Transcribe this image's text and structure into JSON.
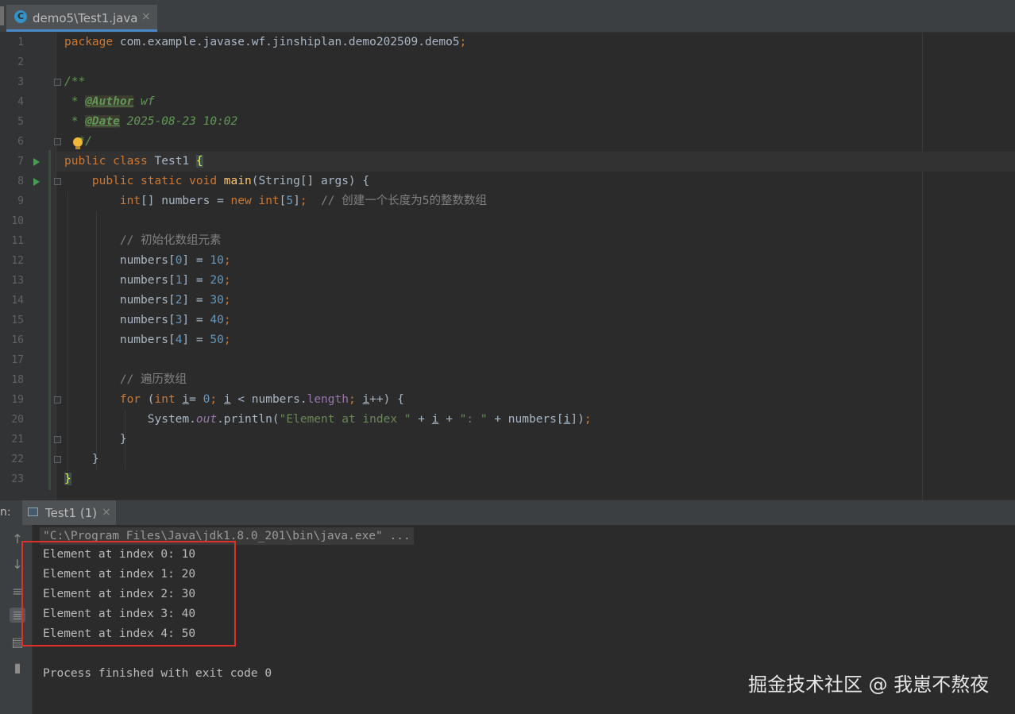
{
  "tab": {
    "icon": "C",
    "title": "demo5\\Test1.java",
    "close": "×"
  },
  "editor": {
    "line_numbers": [
      "1",
      "2",
      "3",
      "4",
      "5",
      "6",
      "7",
      "8",
      "9",
      "10",
      "11",
      "12",
      "13",
      "14",
      "15",
      "16",
      "17",
      "18",
      "19",
      "20",
      "21",
      "22",
      "23"
    ],
    "lines": [
      [
        [
          "kw",
          "package "
        ],
        [
          "",
          "com.example.javase.wf.jinshiplan.demo202509.demo5"
        ],
        [
          "kw",
          ";"
        ]
      ],
      [],
      [
        [
          "doc",
          "/**"
        ]
      ],
      [
        [
          "doc",
          " * "
        ],
        [
          "tag",
          "@Author"
        ],
        [
          "doc",
          " wf"
        ]
      ],
      [
        [
          "doc",
          " * "
        ],
        [
          "tag",
          "@Date"
        ],
        [
          "doc",
          " 2025-08-23 10:02"
        ]
      ],
      [
        [
          "doc",
          "  */"
        ]
      ],
      [
        [
          "kw",
          "public class "
        ],
        [
          "",
          "Test1 "
        ],
        [
          "brace-hl",
          "{"
        ]
      ],
      [
        [
          "",
          "    "
        ],
        [
          "kw",
          "public static void "
        ],
        [
          "fn",
          "main"
        ],
        [
          "",
          "(String[] args) {"
        ]
      ],
      [
        [
          "",
          "        "
        ],
        [
          "kw",
          "int"
        ],
        [
          "",
          "[] numbers = "
        ],
        [
          "kw",
          "new int"
        ],
        [
          "",
          "["
        ],
        [
          "num",
          "5"
        ],
        [
          "",
          "]"
        ],
        [
          "kw",
          ";"
        ],
        [
          "",
          "  "
        ],
        [
          "cm",
          "// 创建一个长度为5的整数数组"
        ]
      ],
      [],
      [
        [
          "",
          "        "
        ],
        [
          "cm",
          "// 初始化数组元素"
        ]
      ],
      [
        [
          "",
          "        numbers["
        ],
        [
          "num",
          "0"
        ],
        [
          "",
          "] = "
        ],
        [
          "num",
          "10"
        ],
        [
          "kw",
          ";"
        ]
      ],
      [
        [
          "",
          "        numbers["
        ],
        [
          "num",
          "1"
        ],
        [
          "",
          "] = "
        ],
        [
          "num",
          "20"
        ],
        [
          "kw",
          ";"
        ]
      ],
      [
        [
          "",
          "        numbers["
        ],
        [
          "num",
          "2"
        ],
        [
          "",
          "] = "
        ],
        [
          "num",
          "30"
        ],
        [
          "kw",
          ";"
        ]
      ],
      [
        [
          "",
          "        numbers["
        ],
        [
          "num",
          "3"
        ],
        [
          "",
          "] = "
        ],
        [
          "num",
          "40"
        ],
        [
          "kw",
          ";"
        ]
      ],
      [
        [
          "",
          "        numbers["
        ],
        [
          "num",
          "4"
        ],
        [
          "",
          "] = "
        ],
        [
          "num",
          "50"
        ],
        [
          "kw",
          ";"
        ]
      ],
      [],
      [
        [
          "",
          "        "
        ],
        [
          "cm",
          "// 遍历数组"
        ]
      ],
      [
        [
          "",
          "        "
        ],
        [
          "kw",
          "for "
        ],
        [
          "",
          "("
        ],
        [
          "kw",
          "int "
        ],
        [
          "ul",
          "i"
        ],
        [
          "",
          "",
          " "
        ],
        [
          "",
          ""
        ],
        [
          "",
          "= "
        ],
        [
          "num",
          "0"
        ],
        [
          "kw",
          "; "
        ],
        [
          "ul",
          "i"
        ],
        [
          "",
          " < numbers."
        ],
        [
          "field",
          "length"
        ],
        [
          "kw",
          "; "
        ],
        [
          "ul",
          "i"
        ],
        [
          "",
          "++) {"
        ]
      ],
      [
        [
          "",
          "            System."
        ],
        [
          "ital-field",
          "out"
        ],
        [
          "",
          ".println("
        ],
        [
          "str",
          "\"Element at index \""
        ],
        [
          "",
          " + "
        ],
        [
          "ul",
          "i"
        ],
        [
          "",
          " + "
        ],
        [
          "str",
          "\": \""
        ],
        [
          "",
          " + numbers["
        ],
        [
          "ul",
          "i"
        ],
        [
          "",
          "])"
        ],
        [
          "kw",
          ";"
        ]
      ],
      [
        [
          "",
          "        }"
        ]
      ],
      [
        [
          "",
          "    }"
        ]
      ],
      [
        [
          "brace-hl",
          "}"
        ]
      ]
    ]
  },
  "run": {
    "prefix": "n:",
    "tab_label": "Test1 (1)",
    "tab_close": "×",
    "command": "\"C:\\Program Files\\Java\\jdk1.8.0_201\\bin\\java.exe\" ...",
    "output": [
      "Element at index 0: 10",
      "Element at index 1: 20",
      "Element at index 2: 30",
      "Element at index 3: 40",
      "Element at index 4: 50",
      "",
      "Process finished with exit code 0"
    ],
    "toolbar_icons": [
      "up-arrow-icon",
      "down-arrow-icon",
      "soft-wrap-icon",
      "scroll-to-end-icon",
      "print-icon",
      "trash-icon"
    ]
  },
  "watermark": "掘金技术社区 @ 我崽不熬夜"
}
